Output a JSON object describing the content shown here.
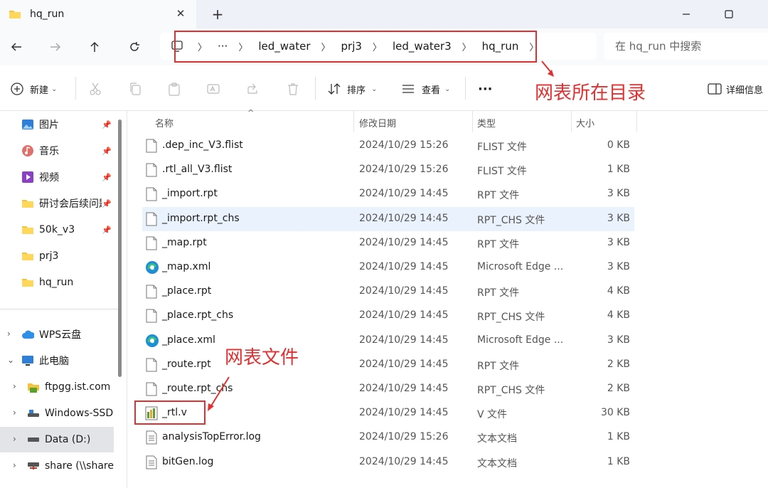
{
  "window": {
    "tab_title": "hq_run",
    "new_tab": "+",
    "close_tab": "✕"
  },
  "address": {
    "overflow": "···",
    "breadcrumbs": [
      "led_water",
      "prj3",
      "led_water3",
      "hq_run"
    ],
    "search_placeholder": "在 hq_run 中搜索"
  },
  "toolbar": {
    "new_label": "新建",
    "sort_label": "排序",
    "view_label": "查看",
    "more_label": "···",
    "details_label": "详细信息"
  },
  "annotations": {
    "netlist_dir": "网表所在目录",
    "netlist_file": "网表文件"
  },
  "sidebar": {
    "quick_access": [
      {
        "label": "图片",
        "pinned": true
      },
      {
        "label": "音乐",
        "pinned": true
      },
      {
        "label": "视频",
        "pinned": true
      },
      {
        "label": "研讨会后续问题",
        "pinned": true
      },
      {
        "label": "50k_v3",
        "pinned": true
      },
      {
        "label": "prj3",
        "pinned": false
      },
      {
        "label": "hq_run",
        "pinned": false
      }
    ],
    "tree": [
      {
        "label": "WPS云盘",
        "expanded": false
      },
      {
        "label": "此电脑",
        "expanded": true
      },
      {
        "label": "ftpgg.ist.com",
        "expanded": false
      },
      {
        "label": "Windows-SSD",
        "expanded": false
      },
      {
        "label": "Data (D:)",
        "expanded": false,
        "selected": true
      },
      {
        "label": "share (\\\\share.i",
        "expanded": false
      }
    ]
  },
  "columns": {
    "name": "名称",
    "date": "修改日期",
    "type": "类型",
    "size": "大小"
  },
  "files": [
    {
      "name": ".dep_inc_V3.flist",
      "date": "2024/10/29 15:26",
      "type": "FLIST 文件",
      "size": "0 KB",
      "icon": "doc-icon"
    },
    {
      "name": ".rtl_all_V3.flist",
      "date": "2024/10/29 15:26",
      "type": "FLIST 文件",
      "size": "1 KB",
      "icon": "doc-icon"
    },
    {
      "name": "_import.rpt",
      "date": "2024/10/29 14:45",
      "type": "RPT 文件",
      "size": "3 KB",
      "icon": "doc-icon"
    },
    {
      "name": "_import.rpt_chs",
      "date": "2024/10/29 14:45",
      "type": "RPT_CHS 文件",
      "size": "3 KB",
      "icon": "doc-icon",
      "selected": true
    },
    {
      "name": "_map.rpt",
      "date": "2024/10/29 14:45",
      "type": "RPT 文件",
      "size": "3 KB",
      "icon": "doc-icon"
    },
    {
      "name": "_map.xml",
      "date": "2024/10/29 14:45",
      "type": "Microsoft Edge ...",
      "size": "3 KB",
      "icon": "edge-icon"
    },
    {
      "name": "_place.rpt",
      "date": "2024/10/29 14:45",
      "type": "RPT 文件",
      "size": "4 KB",
      "icon": "doc-icon"
    },
    {
      "name": "_place.rpt_chs",
      "date": "2024/10/29 14:45",
      "type": "RPT_CHS 文件",
      "size": "4 KB",
      "icon": "doc-icon"
    },
    {
      "name": "_place.xml",
      "date": "2024/10/29 14:45",
      "type": "Microsoft Edge ...",
      "size": "3 KB",
      "icon": "edge-icon"
    },
    {
      "name": "_route.rpt",
      "date": "2024/10/29 14:45",
      "type": "RPT 文件",
      "size": "2 KB",
      "icon": "doc-icon"
    },
    {
      "name": "_route.rpt_chs",
      "date": "2024/10/29 14:45",
      "type": "RPT_CHS 文件",
      "size": "2 KB",
      "icon": "doc-icon"
    },
    {
      "name": "_rtl.v",
      "date": "2024/10/29 14:45",
      "type": "V 文件",
      "size": "30 KB",
      "icon": "verilog-icon"
    },
    {
      "name": "analysisTopError.log",
      "date": "2024/10/29 15:26",
      "type": "文本文档",
      "size": "1 KB",
      "icon": "text-icon"
    },
    {
      "name": "bitGen.log",
      "date": "2024/10/29 14:45",
      "type": "文本文档",
      "size": "1 KB",
      "icon": "text-icon"
    }
  ],
  "colors": {
    "annotation_red": "#e23030",
    "selected_row": "#eaf2fd",
    "folder_yellow": "#f5c33b"
  }
}
